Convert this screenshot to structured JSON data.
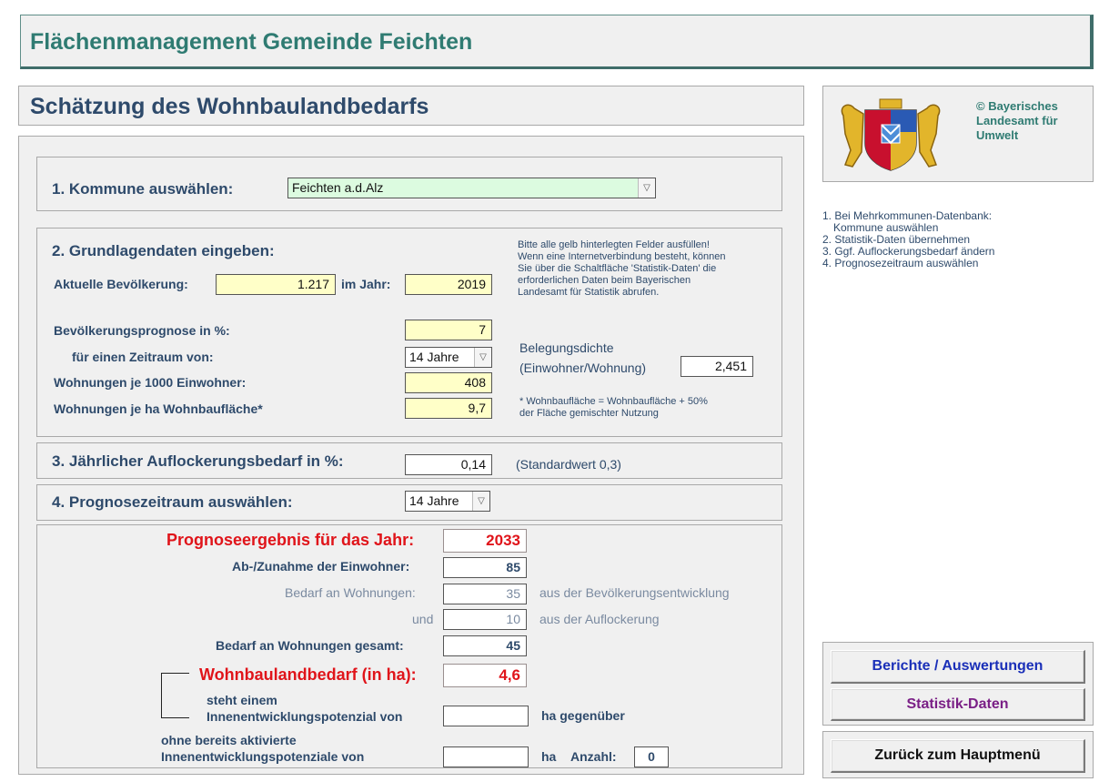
{
  "app": {
    "title": "Flächenmanagement Gemeinde Feichten"
  },
  "page": {
    "title": "Schätzung des Wohnbaulandbedarfs"
  },
  "logo": {
    "caption_line1": "© Bayerisches",
    "caption_line2": "Landesamt für",
    "caption_line3": "Umwelt"
  },
  "instructions": [
    "1. Bei Mehrkommunen-Datenbank:",
    "Kommune auswählen",
    "2. Statistik-Daten übernehmen",
    "3. Ggf. Auflockerungsbedarf ändern",
    "4. Prognosezeitraum auswählen"
  ],
  "section1": {
    "label": "1. Kommune auswählen:",
    "selected": "Feichten a.d.Alz"
  },
  "section2": {
    "label": "2. Grundlagendaten eingeben:",
    "hint": [
      "Bitte alle gelb hinterlegten Felder ausfüllen!",
      "Wenn eine Internetverbindung besteht, können",
      "Sie über die Schaltfläche 'Statistik-Daten' die",
      "erforderlichen Daten beim Bayerischen",
      "Landesamt für Statistik abrufen."
    ],
    "population_label": "Aktuelle Bevölkerung:",
    "population_value": "1.217",
    "year_label": "im Jahr:",
    "year_value": "2019",
    "forecast_label": "Bevölkerungsprognose in %:",
    "forecast_value": "7",
    "period_label": "für einen Zeitraum von:",
    "period_value": "14 Jahre",
    "density_label_1": "Belegungsdichte",
    "density_label_2": "(Einwohner/Wohnung)",
    "density_value": "2,451",
    "dwellings_per_1000_label": "Wohnungen je 1000 Einwohner:",
    "dwellings_per_1000_value": "408",
    "dwellings_per_ha_label": "Wohnungen je ha Wohnbaufläche*",
    "dwellings_per_ha_value": "9,7",
    "footnote_1": "* Wohnbaufläche = Wohnbaufläche + 50%",
    "footnote_2": "der Fläche gemischter Nutzung"
  },
  "section3": {
    "label": "3. Jährlicher Auflockerungsbedarf in %:",
    "value": "0,14",
    "standard": "(Standardwert 0,3)"
  },
  "section4": {
    "label": "4. Prognosezeitraum auswählen:",
    "value": "14 Jahre"
  },
  "results": {
    "year_label": "Prognoseergebnis für das Jahr:",
    "year_value": "2033",
    "change_label": "Ab-/Zunahme der Einwohner:",
    "change_value": "85",
    "demand_label": "Bedarf an Wohnungen:",
    "demand_value": "35",
    "demand_suffix": "aus der Bevölkerungsentwicklung",
    "and_label": "und",
    "and_value": "10",
    "and_suffix": "aus der Auflockerung",
    "total_label": "Bedarf an Wohnungen gesamt:",
    "total_value": "45",
    "land_label": "Wohnbaulandbedarf (in ha):",
    "land_value": "4,6",
    "potential_label_1": "steht einem",
    "potential_label_2": "Innenentwicklungspotenzial von",
    "potential_value": "",
    "potential_suffix": "ha gegenüber",
    "inactive_label_1": "ohne bereits aktivierte",
    "inactive_label_2": "Innenentwicklungspotenziale von",
    "inactive_value": "",
    "inactive_unit": "ha",
    "count_label": "Anzahl:",
    "count_value": "0"
  },
  "buttons": {
    "reports": "Berichte / Auswertungen",
    "statistics": "Statistik-Daten",
    "back": "Zurück zum Hauptmenü"
  },
  "colors": {
    "teal": "#2f7b72",
    "navy": "#2e4a6b",
    "red": "#e0141a",
    "yellow_field": "#ffffc8",
    "reports_text": "#1a2fb8",
    "stats_text": "#7a1f86"
  }
}
